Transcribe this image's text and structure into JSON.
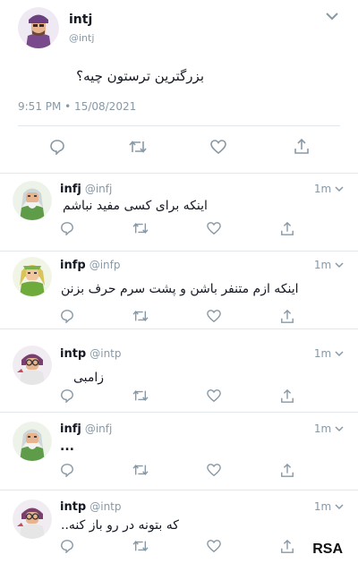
{
  "main_tweet": {
    "name": "intj",
    "handle": "@intj",
    "text": "بزرگترین ترستون چیه؟",
    "timestamp": "9:51 PM • 15/08/2021",
    "avatar_icon": "intj-architect-avatar"
  },
  "replies": [
    {
      "name": "infj",
      "handle": "@infj",
      "time": "1m",
      "text": "اینکه برای کسی مفید نباشم",
      "avatar_icon": "infj-advocate-avatar"
    },
    {
      "name": "infp",
      "handle": "@infp",
      "time": "1m",
      "text": "اینکه ازم متنفر باشن و پشت سرم حرف بزنن",
      "avatar_icon": "infp-mediator-avatar"
    },
    {
      "name": "intp",
      "handle": "@intp",
      "time": "1m",
      "text": "زامبی",
      "avatar_icon": "intp-logician-avatar"
    },
    {
      "name": "infj",
      "handle": "@infj",
      "time": "1m",
      "text": "...",
      "avatar_icon": "infj-advocate-avatar"
    },
    {
      "name": "intp",
      "handle": "@intp",
      "time": "1m",
      "text": "که بتونه در رو باز کنه..",
      "avatar_icon": "intp-logician-avatar"
    }
  ],
  "watermark": "RSA",
  "colors": {
    "muted": "#8899a6",
    "border": "#e1e8ed",
    "text": "#141823"
  }
}
